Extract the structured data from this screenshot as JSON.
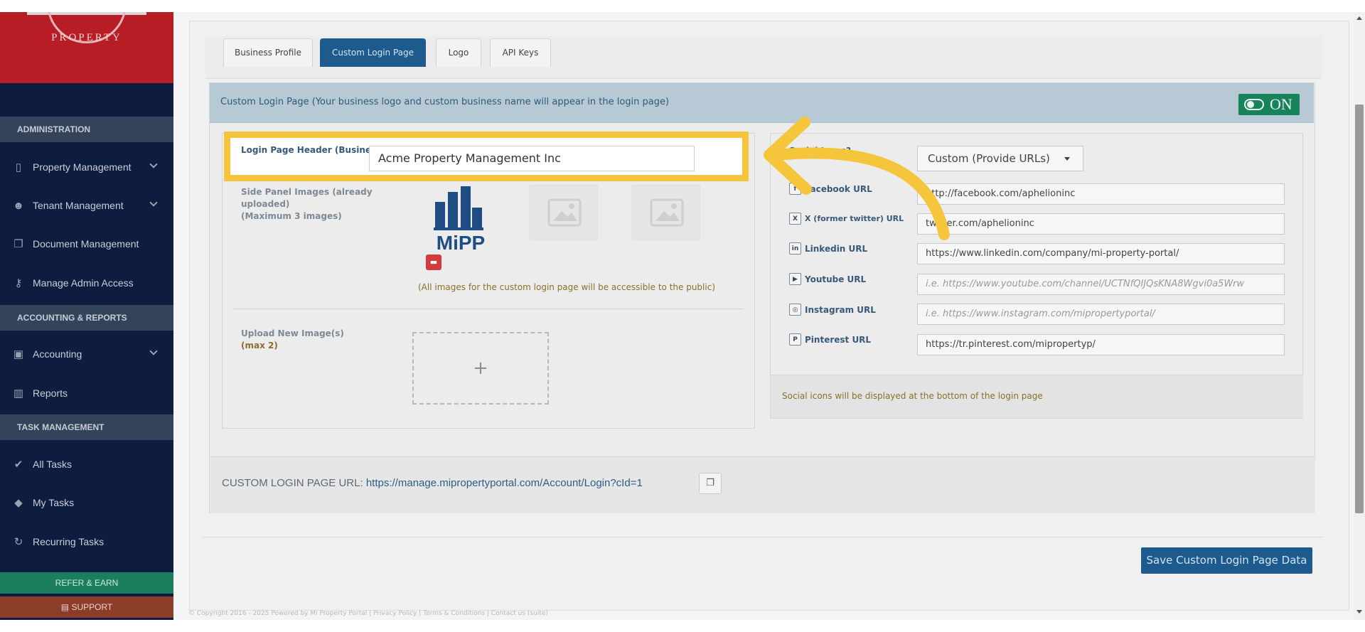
{
  "brand": {
    "name": "PROPERTY"
  },
  "sidebar": {
    "sections": [
      {
        "title": "ADMINISTRATION"
      },
      {
        "title": "ACCOUNTING & REPORTS"
      },
      {
        "title": "TASK MANAGEMENT"
      }
    ],
    "items": [
      {
        "label": "Property Management",
        "icon": "building-icon"
      },
      {
        "label": "Tenant Management",
        "icon": "users-icon"
      },
      {
        "label": "Document Management",
        "icon": "documents-icon"
      },
      {
        "label": "Manage Admin Access",
        "icon": "key-icon"
      },
      {
        "label": "Accounting",
        "icon": "money-icon"
      },
      {
        "label": "Reports",
        "icon": "bar-chart-icon"
      },
      {
        "label": "All Tasks",
        "icon": "check-icon"
      },
      {
        "label": "My Tasks",
        "icon": "tag-icon"
      },
      {
        "label": "Recurring Tasks",
        "icon": "refresh-icon"
      }
    ],
    "refer": "REFER & EARN",
    "support": "SUPPORT"
  },
  "tabs": [
    "Business Profile",
    "Custom Login Page",
    "Logo",
    "API Keys"
  ],
  "card": {
    "title": "Custom Login Page (Your business logo and custom business name will appear in the login page)",
    "toggle": "ON"
  },
  "form": {
    "header_label": "Login Page Header (Business Name)",
    "header_value": "Acme Property Management Inc",
    "side_images_label": [
      "Side Panel Images (already",
      "uploaded)",
      "(Maximum 3 images)"
    ],
    "logo_text": "MiPP",
    "public_note": "(All images for the custom login page will be accessible to the public)",
    "upload_label": "Upload New Image(s)",
    "upload_max": "(max 2)",
    "upload_plus": "+"
  },
  "social": {
    "question": "Social Icons?",
    "select_value": "Custom (Provide URLs)",
    "rows": [
      {
        "label": "Facebook URL",
        "value": "http://facebook.com/aphelioninc",
        "placeholder": "",
        "icon": "facebook-icon",
        "glyph": "f"
      },
      {
        "label": "X (former twitter) URL",
        "value": "twitter.com/aphelioninc",
        "placeholder": "",
        "icon": "x-icon",
        "glyph": "X"
      },
      {
        "label": "Linkedin URL",
        "value": "https://www.linkedin.com/company/mi-property-portal/",
        "placeholder": "",
        "icon": "linkedin-icon",
        "glyph": "in"
      },
      {
        "label": "Youtube URL",
        "value": "",
        "placeholder": "i.e. https://www.youtube.com/channel/UCTNfQIJQsKNA8Wgvi0a5Wrw",
        "icon": "youtube-icon",
        "glyph": "▶"
      },
      {
        "label": "Instagram URL",
        "value": "",
        "placeholder": "i.e. https://www.instagram.com/mipropertyportal/",
        "icon": "instagram-icon",
        "glyph": "◎"
      },
      {
        "label": "Pinterest URL",
        "value": "https://tr.pinterest.com/mipropertyp/",
        "placeholder": "",
        "icon": "pinterest-icon",
        "glyph": "P"
      }
    ],
    "footer_note": "Social icons will be displayed at the bottom of the login page"
  },
  "url_bar": {
    "label": "CUSTOM LOGIN PAGE URL:",
    "url": "https://manage.mipropertyportal.com/Account/Login?cId=1"
  },
  "save_button": "Save Custom Login Page Data",
  "copyright": "© Copyright 2016 - 2025 Powered by Mi Property Portal | Privacy Policy | Terms & Conditions | Contact us (suite)",
  "colors": {
    "sidebar": "#0d1c3f",
    "brand": "#b81d25",
    "accent": "#1d5b8e",
    "toggle_on": "#18825a",
    "highlight": "#f5c53b"
  }
}
